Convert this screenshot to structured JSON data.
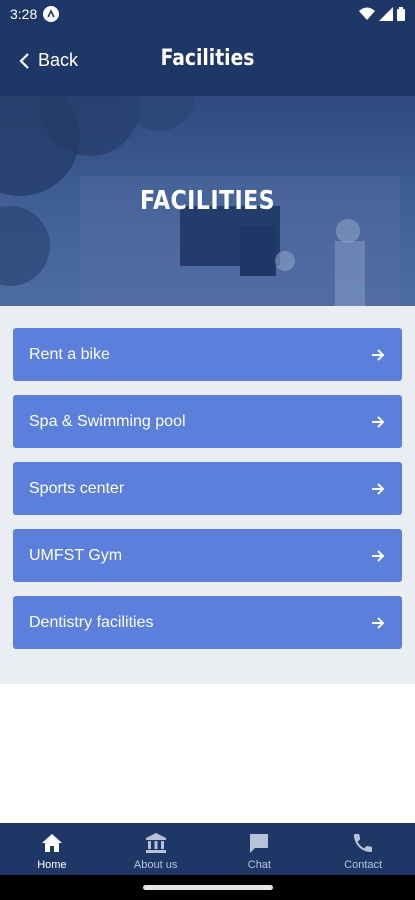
{
  "status_bar": {
    "time": "3:28"
  },
  "app_bar": {
    "back_label": "Back",
    "title": "Facilities"
  },
  "hero": {
    "title": "FACILITIES"
  },
  "facilities": [
    {
      "label": "Rent a bike"
    },
    {
      "label": "Spa & Swimming pool"
    },
    {
      "label": "Sports center"
    },
    {
      "label": "UMFST Gym"
    },
    {
      "label": "Dentistry facilities"
    }
  ],
  "bottom_nav": [
    {
      "label": "Home",
      "icon": "home-icon",
      "active": true
    },
    {
      "label": "About us",
      "icon": "bank-icon",
      "active": false
    },
    {
      "label": "Chat",
      "icon": "chat-icon",
      "active": false
    },
    {
      "label": "Contact",
      "icon": "phone-icon",
      "active": false
    }
  ],
  "colors": {
    "primary": "#1f3766",
    "item_background": "#5b7fdb",
    "list_background": "#eaedf1"
  }
}
